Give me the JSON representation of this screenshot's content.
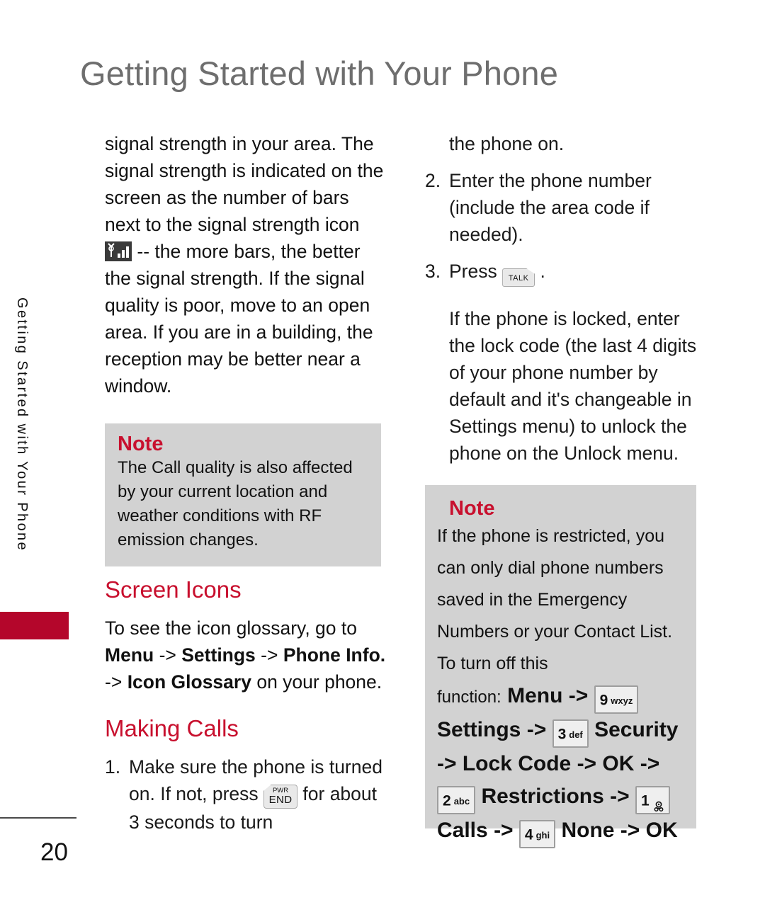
{
  "page": {
    "title": "Getting Started with Your Phone",
    "side_tab_label": "Getting Started with Your Phone",
    "page_number": "20"
  },
  "left_column": {
    "paragraph_part1": "signal strength in your area. The signal strength is indicated on the screen as the number of bars next to the signal strength icon",
    "signal_icon_name": "signal-strength-icon",
    "paragraph_part2": "-- the more bars, the better the signal strength. If the signal quality is poor, move to an open area. If you are in a building, the reception may be better near a window.",
    "note": {
      "title": "Note",
      "body": "The Call quality is also affected by your current location and weather conditions with RF emission changes."
    },
    "screen_icons": {
      "heading": "Screen Icons",
      "intro": "To see the icon glossary, go to",
      "path": [
        {
          "text": "Menu",
          "bold": true
        },
        {
          "text": "->",
          "bold": false
        },
        {
          "text": "Settings",
          "bold": true
        },
        {
          "text": "->",
          "bold": false
        },
        {
          "text": "Phone Info.",
          "bold": true
        },
        {
          "text": "->",
          "bold": false
        },
        {
          "text": "Icon Glossary",
          "bold": true
        },
        {
          "text": "on your phone.",
          "bold": false
        }
      ]
    },
    "making_calls": {
      "heading": "Making Calls",
      "step1_number": "1.",
      "step1_text_before": "Make sure the phone is turned on. If not, press",
      "step1_key": {
        "line1": "PWR",
        "line2": "END",
        "name": "pwr-end-key"
      },
      "step1_text_after": "for about 3 seconds to turn"
    }
  },
  "right_column": {
    "continuation": "the phone on.",
    "step2_number": "2.",
    "step2_text": "Enter the phone number (include the area code if needed).",
    "step3_number": "3.",
    "step3_text_before": "Press",
    "step3_key": {
      "label": "TALK",
      "name": "talk-key"
    },
    "step3_text_after": ".",
    "locked_paragraph": "If the phone is locked, enter the lock code (the last 4 digits of your phone number by default and it's changeable in Settings menu) to unlock the phone on the Unlock menu.",
    "note": {
      "title": "Note",
      "body": "If the phone is restricted, you can only dial phone numbers saved in the Emergency Numbers or your Contact List. To turn off this",
      "sequence_lead": "function:",
      "sequence": [
        {
          "type": "text",
          "value": "Menu"
        },
        {
          "type": "arrow",
          "value": "->"
        },
        {
          "type": "key",
          "digit": "9",
          "letters": "wxyz",
          "name": "key-9"
        },
        {
          "type": "text",
          "value": "Settings"
        },
        {
          "type": "arrow",
          "value": "->"
        },
        {
          "type": "key",
          "digit": "3",
          "letters": "def",
          "name": "key-3"
        },
        {
          "type": "text",
          "value": "Security"
        },
        {
          "type": "arrow",
          "value": "->"
        },
        {
          "type": "text",
          "value": "Lock Code"
        },
        {
          "type": "arrow",
          "value": "->"
        },
        {
          "type": "text",
          "value": "OK"
        },
        {
          "type": "arrow",
          "value": "->"
        },
        {
          "type": "key",
          "digit": "2",
          "letters": "abc",
          "name": "key-2"
        },
        {
          "type": "text",
          "value": "Restrictions"
        },
        {
          "type": "arrow",
          "value": "->"
        },
        {
          "type": "key",
          "digit": "1",
          "letters": "voicemail",
          "name": "key-1"
        },
        {
          "type": "text",
          "value": "Calls"
        },
        {
          "type": "arrow",
          "value": "->"
        },
        {
          "type": "key",
          "digit": "4",
          "letters": "ghi",
          "name": "key-4"
        },
        {
          "type": "text",
          "value": "None"
        },
        {
          "type": "arrow",
          "value": "->"
        },
        {
          "type": "text",
          "value": "OK"
        }
      ]
    }
  },
  "colors": {
    "accent_red": "#c8102e",
    "tab_red": "#b4062b",
    "title_gray": "#6e6e6e",
    "note_bg": "#d2d2d2"
  }
}
